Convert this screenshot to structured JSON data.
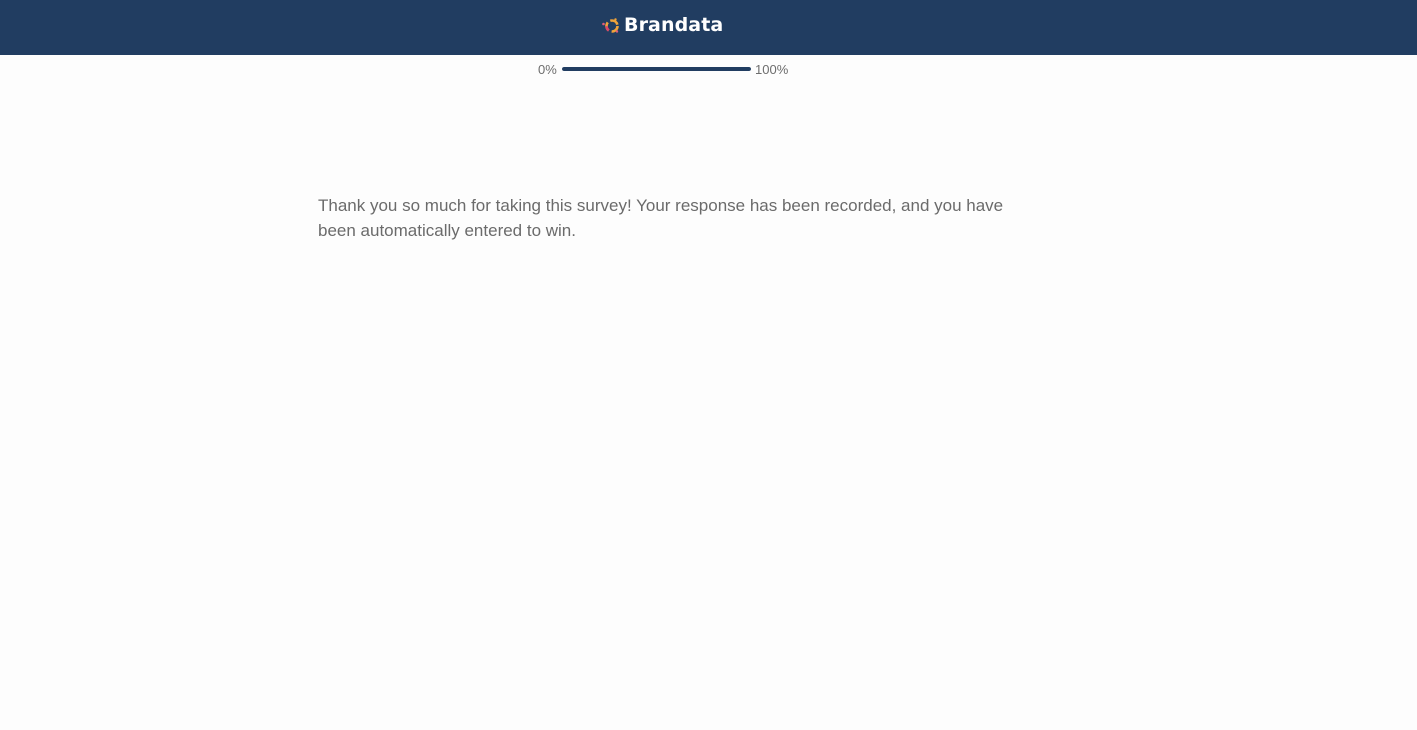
{
  "header": {
    "logo_text": "Brandata",
    "logo_icon": "brandata-logo-icon",
    "background_color": "#213d61"
  },
  "progress": {
    "start_label": "0%",
    "end_label": "100%",
    "value_percent": 100,
    "fill_color": "#213d61"
  },
  "message": {
    "text": "Thank you so much for taking this survey!  Your response has been recorded, and you have been automatically entered to win."
  }
}
